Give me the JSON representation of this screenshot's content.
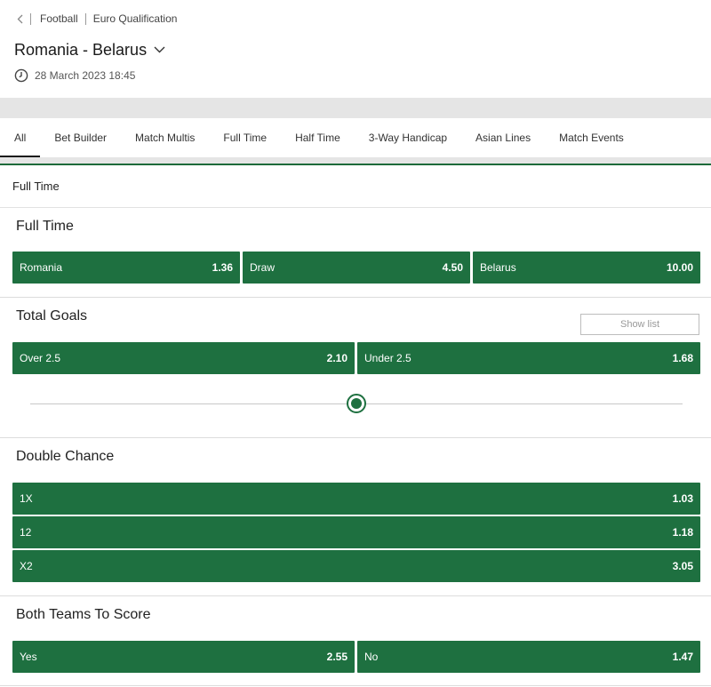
{
  "breadcrumb": {
    "items": [
      "Football",
      "Euro Qualification"
    ]
  },
  "event": {
    "title": "Romania - Belarus",
    "datetime": "28 March 2023 18:45"
  },
  "tabs": [
    "All",
    "Bet Builder",
    "Match Multis",
    "Full Time",
    "Half Time",
    "3-Way Handicap",
    "Asian Lines",
    "Match Events"
  ],
  "active_tab": "All",
  "section_header": "Full Time",
  "markets": {
    "full_time": {
      "title": "Full Time",
      "selections": [
        {
          "label": "Romania",
          "odds": "1.36"
        },
        {
          "label": "Draw",
          "odds": "4.50"
        },
        {
          "label": "Belarus",
          "odds": "10.00"
        }
      ]
    },
    "total_goals": {
      "title": "Total Goals",
      "show_list": "Show list",
      "selections": [
        {
          "label": "Over 2.5",
          "odds": "2.10"
        },
        {
          "label": "Under 2.5",
          "odds": "1.68"
        }
      ],
      "slider_position": 0.5
    },
    "double_chance": {
      "title": "Double Chance",
      "selections": [
        {
          "label": "1X",
          "odds": "1.03"
        },
        {
          "label": "12",
          "odds": "1.18"
        },
        {
          "label": "X2",
          "odds": "3.05"
        }
      ]
    },
    "btts": {
      "title": "Both Teams To Score",
      "selections": [
        {
          "label": "Yes",
          "odds": "2.55"
        },
        {
          "label": "No",
          "odds": "1.47"
        }
      ]
    }
  },
  "colors": {
    "accent_green": "#1e7040",
    "band_grey": "#e5e5e5"
  },
  "icons": {
    "back": "chevron-left-icon",
    "dropdown": "chevron-down-icon",
    "time": "clock-icon"
  }
}
